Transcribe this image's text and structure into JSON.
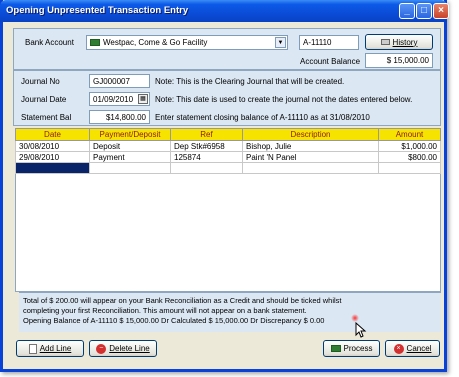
{
  "window": {
    "title": "Opening Unpresented Transaction Entry"
  },
  "bank": {
    "label": "Bank Account",
    "value": "Westpac, Come & Go Facility",
    "code": "A-11110",
    "history_label": "History",
    "balance_label": "Account Balance",
    "balance": "$ 15,000.00"
  },
  "journal": {
    "no_label": "Journal No",
    "no_value": "GJ000007",
    "no_note": "Note: This is the Clearing Journal that will be created.",
    "date_label": "Journal Date",
    "date_value": "01/09/2010",
    "date_note": "Note: This date is used to create the journal not the dates entered below.",
    "stmt_label": "Statement Bal",
    "stmt_value": "$14,800.00",
    "stmt_note": "Enter statement closing balance of A-11110 as at 31/08/2010"
  },
  "table": {
    "headers": [
      "Date",
      "Payment/Deposit",
      "Ref",
      "Description",
      "Amount"
    ],
    "rows": [
      [
        "30/08/2010",
        "Deposit",
        "Dep Stk#6958",
        "Bishop, Julie",
        "$1,000.00"
      ],
      [
        "29/08/2010",
        "Payment",
        "125874",
        "Paint 'N Panel",
        "$800.00"
      ]
    ]
  },
  "info": {
    "line1": "Total of $ 200.00 will appear on your Bank Reconciliation as a Credit and should be ticked whilst",
    "line2": "completing your first Reconciliation. This amount will not appear on a bank statement.",
    "line3": "Opening Balance of A-11110 $ 15,000.00 Dr Calculated $ 15,000.00 Dr Discrepancy $ 0.00"
  },
  "buttons": {
    "add_line": "Add Line",
    "delete_line": "Delete Line",
    "process": "Process",
    "cancel": "Cancel"
  },
  "colors": {
    "header_yellow": "#f7e300",
    "selected_cell": "#0a246a",
    "title_blue": "#0a49d3"
  }
}
